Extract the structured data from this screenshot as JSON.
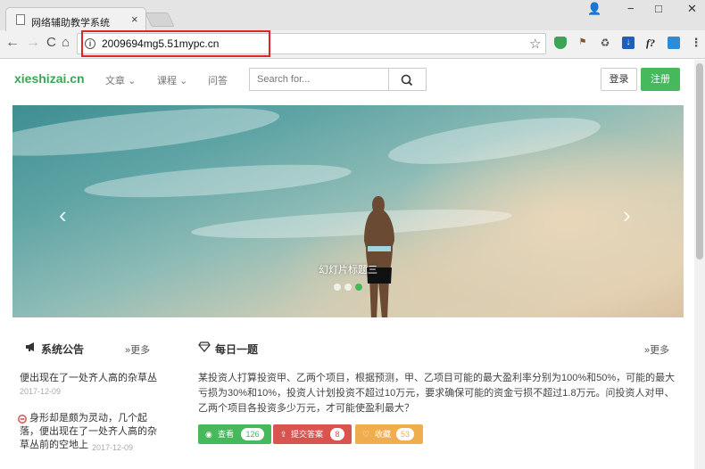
{
  "browser": {
    "tab_title": "网络辅助教学系统",
    "tab_close": "×",
    "url": "2009694mg5.51mypc.cn",
    "window_controls": {
      "account": "👤",
      "minimize": "−",
      "maximize": "□",
      "close": "✕"
    },
    "nav": {
      "back": "←",
      "forward": "→",
      "reload": "C",
      "home": "⌂"
    },
    "star": "☆",
    "extensions": [
      "shield-icon",
      "flag-icon",
      "recycle-icon",
      "download-icon",
      "fx-icon",
      "display-icon",
      "menu-icon"
    ],
    "ext_fx_label": "f?"
  },
  "site": {
    "logo": "xieshizai.cn",
    "nav_items": [
      {
        "label": "文章",
        "chevron": "⌄"
      },
      {
        "label": "课程",
        "chevron": "⌄"
      },
      {
        "label": "问答"
      }
    ],
    "search_placeholder": "Search for...",
    "login": "登录",
    "register": "注册",
    "accent": "#46b95c"
  },
  "carousel": {
    "caption": "幻灯片标题三",
    "slides": 3,
    "active_slide": 3,
    "prev": "‹",
    "next": "›"
  },
  "notice": {
    "title": "系统公告",
    "more": "»更多",
    "items": [
      {
        "text": "便出现在了一处齐人高的杂草丛",
        "date": "2017-12-09"
      },
      {
        "text": "身形却是颇为灵动，几个起落，便出现在了一处齐人高的杂草丛前的空地上",
        "date": "2017-12-09"
      }
    ]
  },
  "daily": {
    "title": "每日一题",
    "more": "»更多",
    "question": "某投资人打算投资甲、乙两个项目，根据预测，甲、乙项目可能的最大盈利率分别为100%和50%，可能的最大亏损为30%和10%，投资人计划投资不超过10万元，要求确保可能的资金亏损不超过1.8万元。问投资人对甲、乙两个项目各投资多少万元，才可能使盈利最大？",
    "actions": [
      {
        "label": "查看",
        "count": "126",
        "color": "#46b95c"
      },
      {
        "label": "提交答案",
        "count": "8",
        "color": "#d9534f"
      },
      {
        "label": "收藏",
        "count": "53",
        "color": "#f0ad4e"
      }
    ]
  }
}
